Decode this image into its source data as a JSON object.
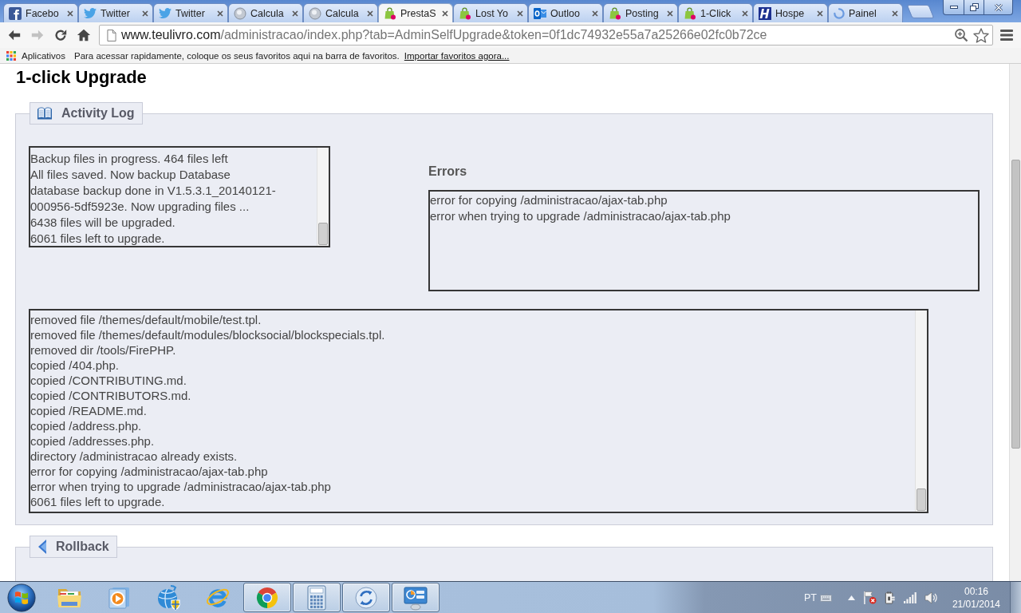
{
  "browser": {
    "tabs": [
      {
        "title": "Facebo",
        "kind": "f-logo",
        "selected": false
      },
      {
        "title": "Twitter",
        "kind": "bird",
        "selected": false
      },
      {
        "title": "Twitter",
        "kind": "bird",
        "selected": false
      },
      {
        "title": "Calcula",
        "kind": "orb",
        "selected": false
      },
      {
        "title": "Calcula",
        "kind": "orb",
        "selected": false
      },
      {
        "title": "PrestaS",
        "kind": "bag",
        "selected": true
      },
      {
        "title": "Lost Yo",
        "kind": "bag",
        "selected": false
      },
      {
        "title": "Outloo",
        "kind": "mail",
        "selected": false
      },
      {
        "title": "Posting",
        "kind": "bag",
        "selected": false
      },
      {
        "title": "1-Click",
        "kind": "bag",
        "selected": false
      },
      {
        "title": "Hospe",
        "kind": "h-logo",
        "selected": false
      },
      {
        "title": "Painel",
        "kind": "spinner",
        "selected": false
      }
    ],
    "address": {
      "host": "www.teulivro.com",
      "path": "/administracao/index.php?tab=AdminSelfUpgrade&token=0f1dc74932e55a7a25266e02fc0b72ce"
    },
    "bookmarks_bar": {
      "apps": "Aplicativos",
      "hint": "Para acessar rapidamente, coloque os seus favoritos aqui na barra de favoritos.",
      "import_link": "Importar favoritos agora..."
    }
  },
  "page": {
    "title": "1-click Upgrade",
    "activity_log": {
      "legend": "Activity Log",
      "log": [
        "Backup files in progress. 464 files left",
        "All files saved. Now backup Database",
        "database backup done in V1.5.3.1_20140121-",
        "000956-5df5923e. Now upgrading files ...",
        "6438 files will be upgraded.",
        "6061 files left to upgrade."
      ],
      "errors_heading": "Errors",
      "errors": [
        "error for copying /administracao/ajax-tab.php",
        "error when trying to upgrade /administracao/ajax-tab.php"
      ],
      "details": [
        "removed file /themes/default/mobile/test.tpl.",
        "removed file /themes/default/modules/blocksocial/blockspecials.tpl.",
        "removed dir /tools/FirePHP.",
        "copied /404.php.",
        "copied /CONTRIBUTING.md.",
        "copied /CONTRIBUTORS.md.",
        "copied /README.md.",
        "copied /address.php.",
        "copied /addresses.php.",
        "directory /administracao already exists.",
        "error for copying /administracao/ajax-tab.php",
        "error when trying to upgrade /administracao/ajax-tab.php",
        "6061 files left to upgrade."
      ]
    },
    "rollback": {
      "legend": "Rollback"
    }
  },
  "taskbar": {
    "pinned": [
      {
        "kind": "folder",
        "running": false
      },
      {
        "kind": "player",
        "running": false
      },
      {
        "kind": "globe",
        "running": false
      },
      {
        "kind": "ebrowser",
        "running": false
      },
      {
        "kind": "rings",
        "running": true
      },
      {
        "kind": "calculator",
        "running": true
      },
      {
        "kind": "sync",
        "running": true
      },
      {
        "kind": "panel",
        "running": true
      }
    ],
    "tray": {
      "language": "PT",
      "time": "00:16",
      "date": "21/01/2014"
    }
  }
}
